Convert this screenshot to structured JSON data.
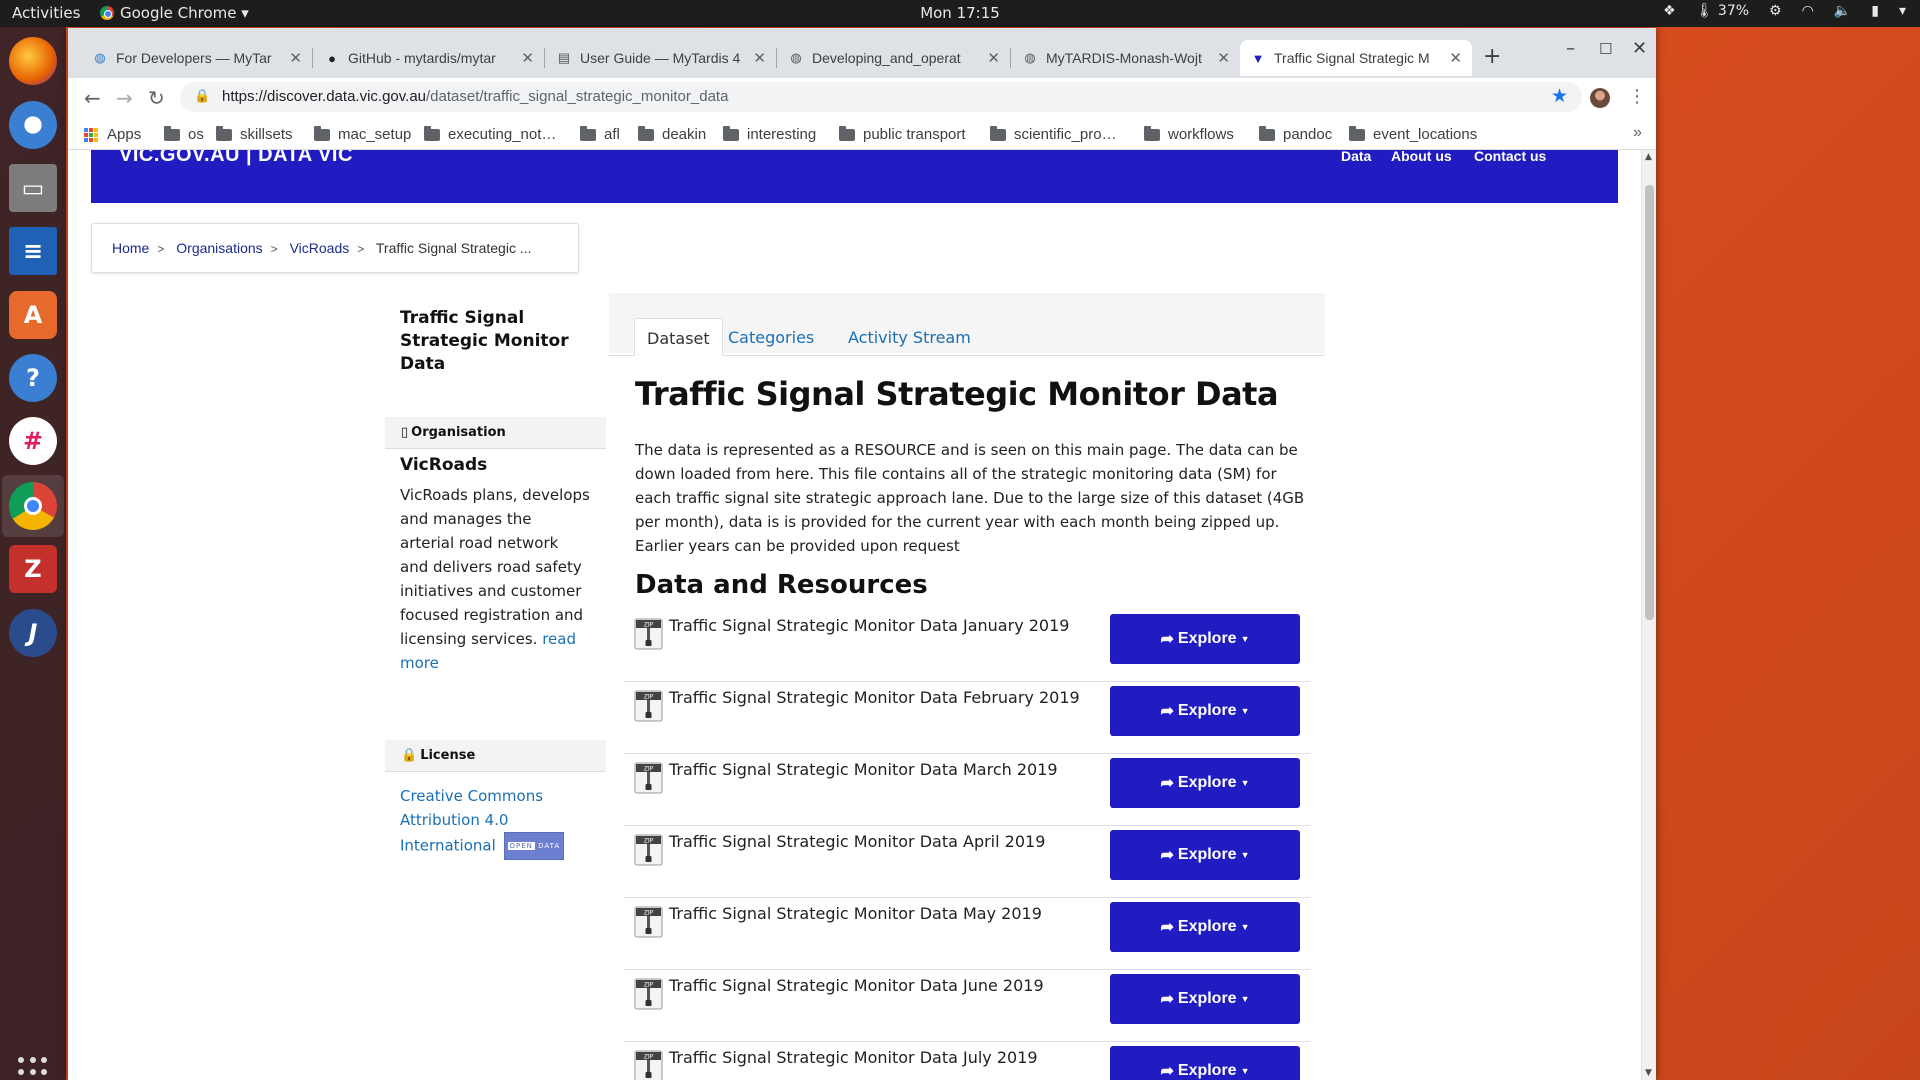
{
  "topbar": {
    "activities": "Activities",
    "app": "Google Chrome ▾",
    "clock": "Mon 17:15",
    "battery_temp": "37%"
  },
  "browser": {
    "tabs": [
      {
        "label": "For Developers — MyTar",
        "icon": "globe-icon"
      },
      {
        "label": "GitHub - mytardis/mytar",
        "icon": "github-icon"
      },
      {
        "label": "User Guide — MyTardis 4",
        "icon": "doc-icon"
      },
      {
        "label": "Developing_and_operat",
        "icon": "globe-icon"
      },
      {
        "label": "MyTARDIS-Monash-Wojt",
        "icon": "globe-icon"
      },
      {
        "label": "Traffic Signal Strategic M",
        "icon": "datavic-icon",
        "active": true
      }
    ],
    "url_host": "https://discover.data.vic.gov.au",
    "url_path": "/dataset/traffic_signal_strategic_monitor_data",
    "bookmarks": [
      "Apps",
      "os",
      "skillsets",
      "mac_setup",
      "executing_not…",
      "afl",
      "deakin",
      "interesting",
      "public transport",
      "scientific_pro…",
      "workflows",
      "pandoc",
      "event_locations"
    ],
    "accent": "#1a73e8"
  },
  "site": {
    "brand": "VIC.GOV.AU | DATA VIC",
    "nav": [
      "Data",
      "About us",
      "Contact us"
    ],
    "brand_color": "#201cc2",
    "breadcrumbs": [
      "Home",
      "Organisations",
      "VicRoads"
    ],
    "breadcrumb_current": "Traffic Signal Strategic ..."
  },
  "sidebar": {
    "dataset_title": "Traffic Signal Strategic Monitor Data",
    "org_heading": "Organisation",
    "org_name": "VicRoads",
    "org_description": "VicRoads plans, develops and manages the arterial road network and delivers road safety initiatives and customer focused registration and licensing services.",
    "read_more": "read more",
    "license_heading": "License",
    "license_text": "Creative Commons Attribution 4.0 International",
    "badge_open": "OPEN",
    "badge_data": "DATA"
  },
  "main": {
    "tabs": [
      "Dataset",
      "Categories",
      "Activity Stream"
    ],
    "title": "Traffic Signal Strategic Monitor Data",
    "notes": "The data is represented as a RESOURCE and is seen on this main page. The data can be down loaded from here. This file contains all of the strategic monitoring data (SM) for each traffic signal site strategic approach lane. Due to the large size of this dataset (4GB per month), data is is provided for the current year with each month being zipped up. Earlier years can be provided upon request",
    "resources_heading": "Data and Resources",
    "explore_label": "Explore",
    "resources": [
      "Traffic Signal Strategic Monitor Data January 2019",
      "Traffic Signal Strategic Monitor Data February 2019",
      "Traffic Signal Strategic Monitor Data March 2019",
      "Traffic Signal Strategic Monitor Data April 2019",
      "Traffic Signal Strategic Monitor Data May 2019",
      "Traffic Signal Strategic Monitor Data June 2019",
      "Traffic Signal Strategic Monitor Data July 2019"
    ]
  }
}
